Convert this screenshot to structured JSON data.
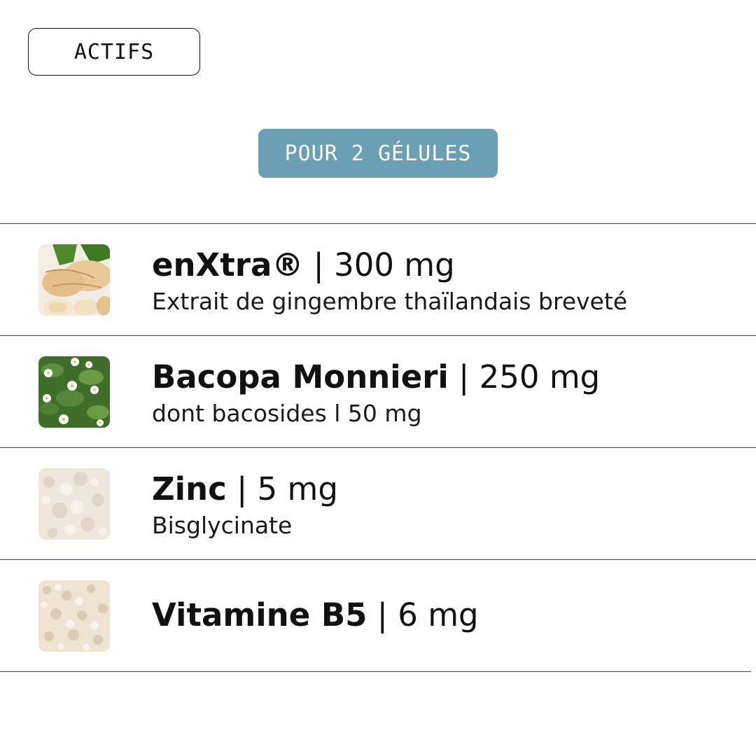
{
  "header": {
    "tag_label": "ACTIFS",
    "dose_label": "POUR 2 GÉLULES"
  },
  "ingredients": [
    {
      "name": "enXtra®",
      "separator": " | ",
      "dose": "300 mg",
      "description": "Extrait de gingembre thaïlandais breveté",
      "image": "ginger-root-image"
    },
    {
      "name": "Bacopa Monnieri",
      "separator": " | ",
      "dose": "250 mg",
      "description": "dont bacosides l 50 mg",
      "image": "bacopa-flowers-image"
    },
    {
      "name": "Zinc",
      "separator": " | ",
      "dose": "5 mg",
      "description": "Bisglycinate",
      "image": "zinc-powder-image"
    },
    {
      "name": "Vitamine B5",
      "separator": " | ",
      "dose": "6 mg",
      "description": "",
      "image": "vitamin-b5-powder-image"
    }
  ],
  "colors": {
    "pill_background": "#6b9fb5",
    "text": "#111111",
    "divider": "#444444"
  }
}
